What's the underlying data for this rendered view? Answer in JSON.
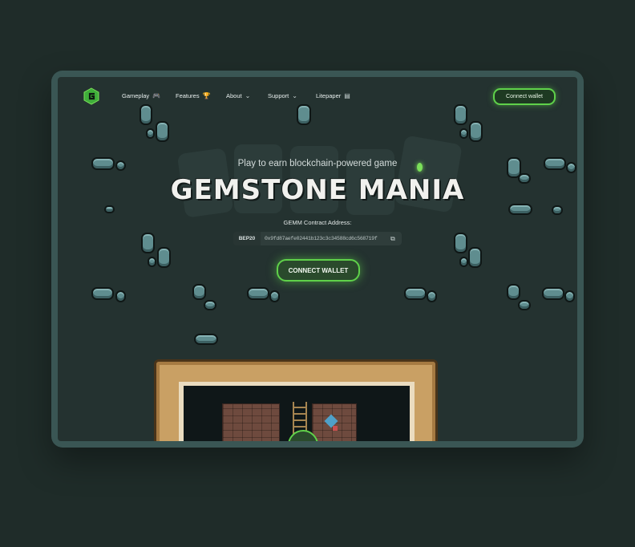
{
  "nav": {
    "items": [
      {
        "label": "Gameplay",
        "icon": "gamepad-icon"
      },
      {
        "label": "Features",
        "icon": "trophy-icon"
      },
      {
        "label": "About",
        "icon": "chevron-down-icon"
      },
      {
        "label": "Support",
        "icon": "chevron-down-icon"
      },
      {
        "label": "Litepaper",
        "icon": "document-icon"
      }
    ],
    "connect_label": "Connect wallet"
  },
  "hero": {
    "subtitle": "Play to earn blockchain-powered game",
    "title": "GEMSTONE MANIA",
    "contract_label": "GEMM Contract Address:",
    "chain": "BEP20",
    "address": "0x9fd87aefe02441b123c3c34588cd6c568719f",
    "connect_label": "CONNECT WALLET"
  },
  "colors": {
    "accent": "#5fd14a",
    "background": "#243230",
    "frame": "#3a5654"
  }
}
